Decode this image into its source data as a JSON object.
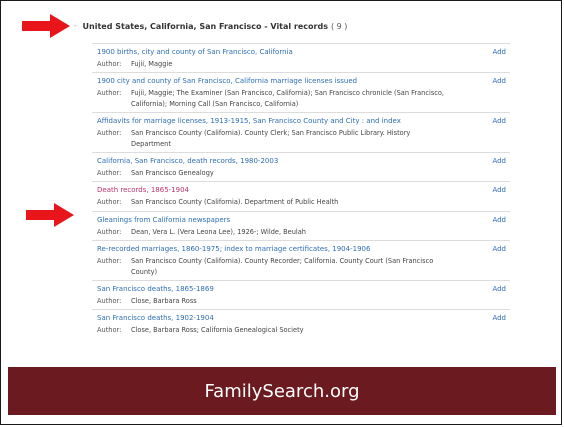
{
  "section": {
    "toggle": "-",
    "title": "United States, California, San Francisco - Vital records",
    "count": "( 9 )"
  },
  "author_label": "Author:",
  "add_label": "Add",
  "records": [
    {
      "title": "1900 births, city and county of San Francisco, California",
      "author": "Fujii, Maggie"
    },
    {
      "title": "1900 city and county of San Francisco, California marriage licenses issued",
      "author": "Fujii, Maggie; The Examiner (San Francisco, California); San Francisco chronicle (San Francisco, California); Morning Call (San Francisco, California)"
    },
    {
      "title": "Affidavits for marriage licenses, 1913-1915, San Francisco County and City : and index",
      "author": "San Francisco County (California). County Clerk; San Francisco Public Library. History Department"
    },
    {
      "title": "California, San Francisco, death records, 1980-2003",
      "author": "San Francisco Genealogy"
    },
    {
      "title": "Death records, 1865-1904",
      "author": "San Francisco County (California). Department of Public Health"
    },
    {
      "title": "Gleanings from California newspapers",
      "author": "Dean, Vera L. (Vera Leona Lee), 1926-; Wilde, Beulah"
    },
    {
      "title": "Re-recorded marriages, 1860-1975; index to marriage certificates, 1904-1906",
      "author": "San Francisco County (California). County Recorder; California. County Court (San Francisco County)"
    },
    {
      "title": "San Francisco deaths, 1865-1869",
      "author": "Close, Barbara Ross"
    },
    {
      "title": "San Francisco deaths, 1902-1904",
      "author": "Close, Barbara Ross; California Genealogical Society"
    }
  ],
  "banner": {
    "text": "FamilySearch.org"
  },
  "colors": {
    "link": "#2c6eb5",
    "visited": "#c2326b",
    "arrow": "#e8161b",
    "banner": "#6b1a1f"
  }
}
